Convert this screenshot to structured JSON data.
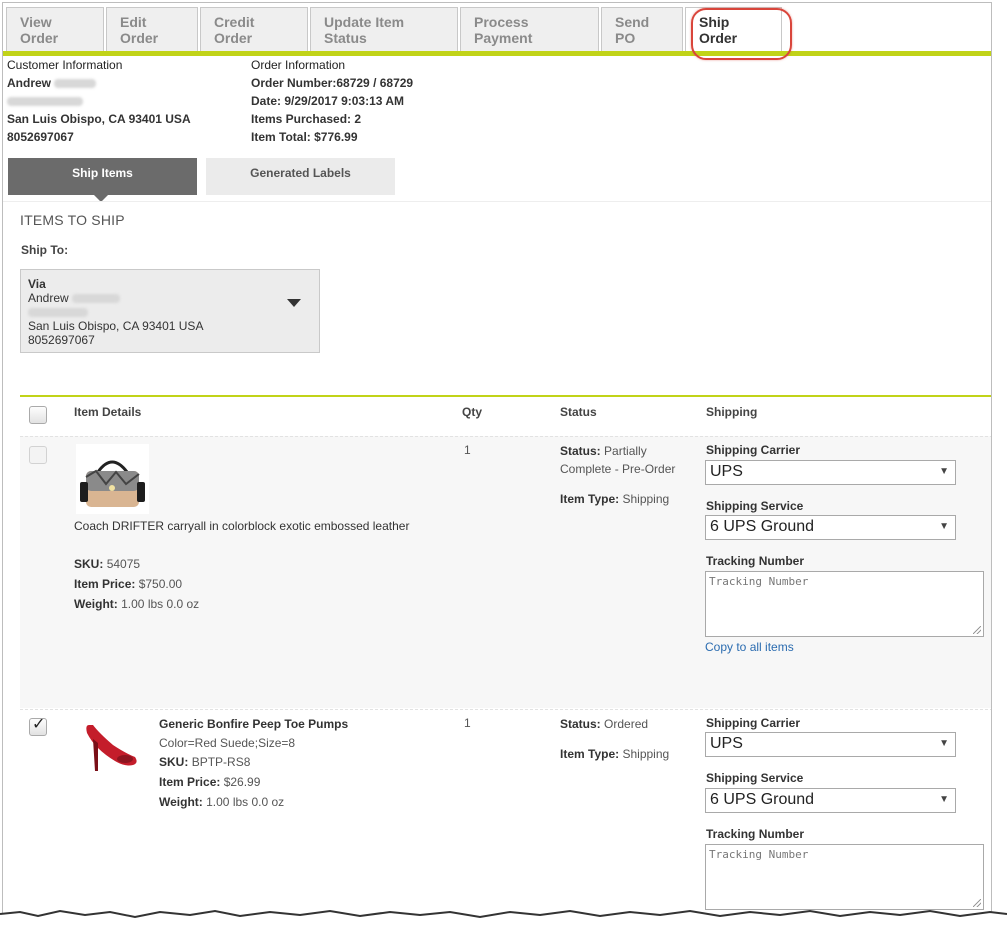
{
  "top_tabs": [
    "View Order",
    "Edit Order",
    "Credit Order",
    "Update Item Status",
    "Process Payment",
    "Send PO",
    "Ship Order"
  ],
  "customer": {
    "heading": "Customer Information",
    "first_name": "Andrew",
    "city_line": "San Luis Obispo, CA 93401 USA",
    "phone": "8052697067"
  },
  "order": {
    "heading": "Order Information",
    "number_label": "Order Number:",
    "number": "68729 / 68729",
    "date_label": "Date:",
    "date": "9/29/2017 9:03:13 AM",
    "items_label": "Items Purchased:",
    "items": "2",
    "total_label": "Item Total:",
    "total": "$776.99"
  },
  "sub_tabs": {
    "active": "Ship Items",
    "inactive": "Generated Labels"
  },
  "items_to_ship": "ITEMS TO SHIP",
  "ship_to": {
    "label": "Ship To:",
    "via": "Via",
    "name": "Andrew",
    "city_line": "San Luis Obispo, CA 93401 USA",
    "phone": "8052697067"
  },
  "table": {
    "headers": {
      "details": "Item Details",
      "qty": "Qty",
      "status": "Status",
      "shipping": "Shipping"
    }
  },
  "labels": {
    "status": "Status:",
    "item_type": "Item Type:",
    "sku": "SKU:",
    "price": "Item Price:",
    "weight": "Weight:",
    "carrier": "Shipping Carrier",
    "service": "Shipping Service",
    "tracking": "Tracking Number",
    "tracking_placeholder": "Tracking Number",
    "copy_link": "Copy to all items"
  },
  "items": [
    {
      "name": "Coach DRIFTER carryall in colorblock exotic embossed leather",
      "sku": "54075",
      "price": "$750.00",
      "weight": "1.00 lbs 0.0 oz",
      "qty": "1",
      "status_line1": "Partially",
      "status_line2": "Complete - Pre-Order",
      "item_type": "Shipping",
      "carrier": "UPS",
      "service": "6 UPS Ground",
      "checked": false
    },
    {
      "name": "Generic Bonfire Peep Toe Pumps",
      "variant": "Color=Red Suede;Size=8",
      "sku": "BPTP-RS8",
      "price": "$26.99",
      "weight": "1.00 lbs 0.0 oz",
      "qty": "1",
      "status": "Ordered",
      "item_type": "Shipping",
      "carrier": "UPS",
      "service": "6 UPS Ground",
      "checked": true
    }
  ],
  "colors": {
    "accent": "#c1d318",
    "active_tab": "#6b6b6b",
    "highlight": "#d9453b",
    "link": "#2b6cb0"
  }
}
